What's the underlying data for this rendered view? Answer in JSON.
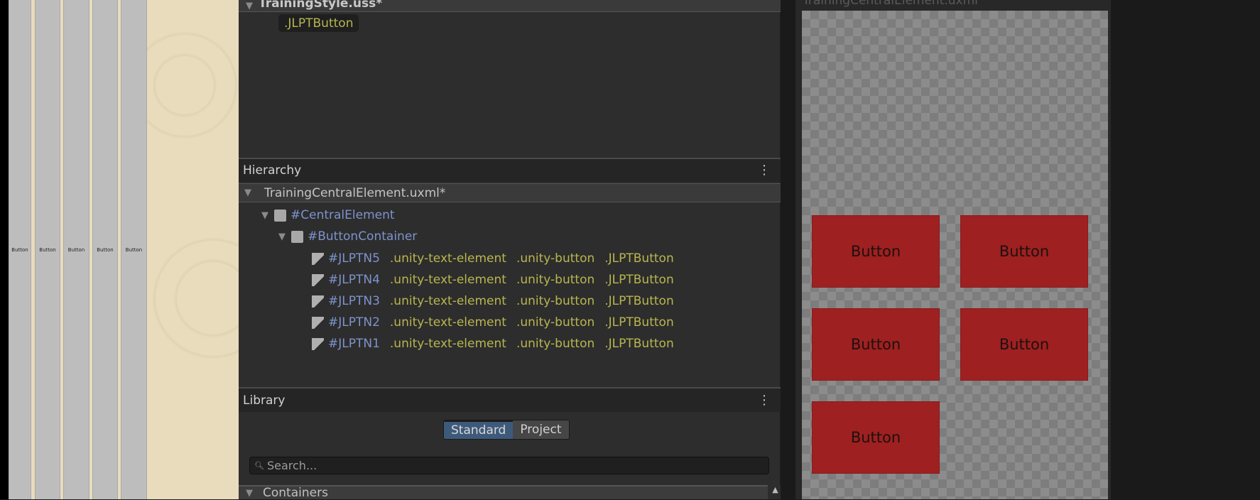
{
  "game_view": {
    "buttons": [
      "Button",
      "Button",
      "Button",
      "Button",
      "Button"
    ]
  },
  "stylesheet": {
    "title": "TrainingStyle.uss*",
    "selector": ".JLPTButton"
  },
  "hierarchy": {
    "title": "Hierarchy",
    "file": "TrainingCentralElement.uxml*",
    "central": "#CentralElement",
    "container": "#ButtonContainer",
    "items": [
      {
        "id": "#JLPTN5",
        "classes": [
          ".unity-text-element",
          ".unity-button",
          ".JLPTButton"
        ]
      },
      {
        "id": "#JLPTN4",
        "classes": [
          ".unity-text-element",
          ".unity-button",
          ".JLPTButton"
        ]
      },
      {
        "id": "#JLPTN3",
        "classes": [
          ".unity-text-element",
          ".unity-button",
          ".JLPTButton"
        ]
      },
      {
        "id": "#JLPTN2",
        "classes": [
          ".unity-text-element",
          ".unity-button",
          ".JLPTButton"
        ]
      },
      {
        "id": "#JLPTN1",
        "classes": [
          ".unity-text-element",
          ".unity-button",
          ".JLPTButton"
        ]
      }
    ]
  },
  "library": {
    "title": "Library",
    "tabs": [
      "Standard",
      "Project"
    ],
    "search_placeholder": "Search...",
    "section": "Containers"
  },
  "viewport": {
    "title": "TrainingCentralElement.uxml",
    "buttons": [
      "Button",
      "Button",
      "Button",
      "Button",
      "Button"
    ]
  },
  "colors": {
    "button_red": "#9e2020",
    "selector_yellow": "#b8b650",
    "name_blue": "#7d93cc",
    "tab_active": "#3e5a7a"
  }
}
